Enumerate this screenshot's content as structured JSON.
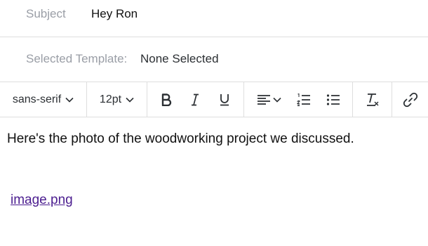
{
  "subject": {
    "label": "Subject",
    "value": "Hey Ron"
  },
  "template": {
    "label": "Selected Template:",
    "value": "None Selected"
  },
  "toolbar": {
    "font_family": "sans-serif",
    "font_size": "12pt",
    "icons": [
      "bold-icon",
      "italic-icon",
      "underline-icon",
      "align-left-icon",
      "ordered-list-icon",
      "unordered-list-icon",
      "clear-format-icon",
      "link-icon"
    ]
  },
  "body": {
    "text": "Here's the photo of the woodworking project we discussed.",
    "attachment": "image.png"
  },
  "colors": {
    "label_gray": "#9a9ea6",
    "link": "#4b1d8f",
    "divider": "#dedede"
  }
}
